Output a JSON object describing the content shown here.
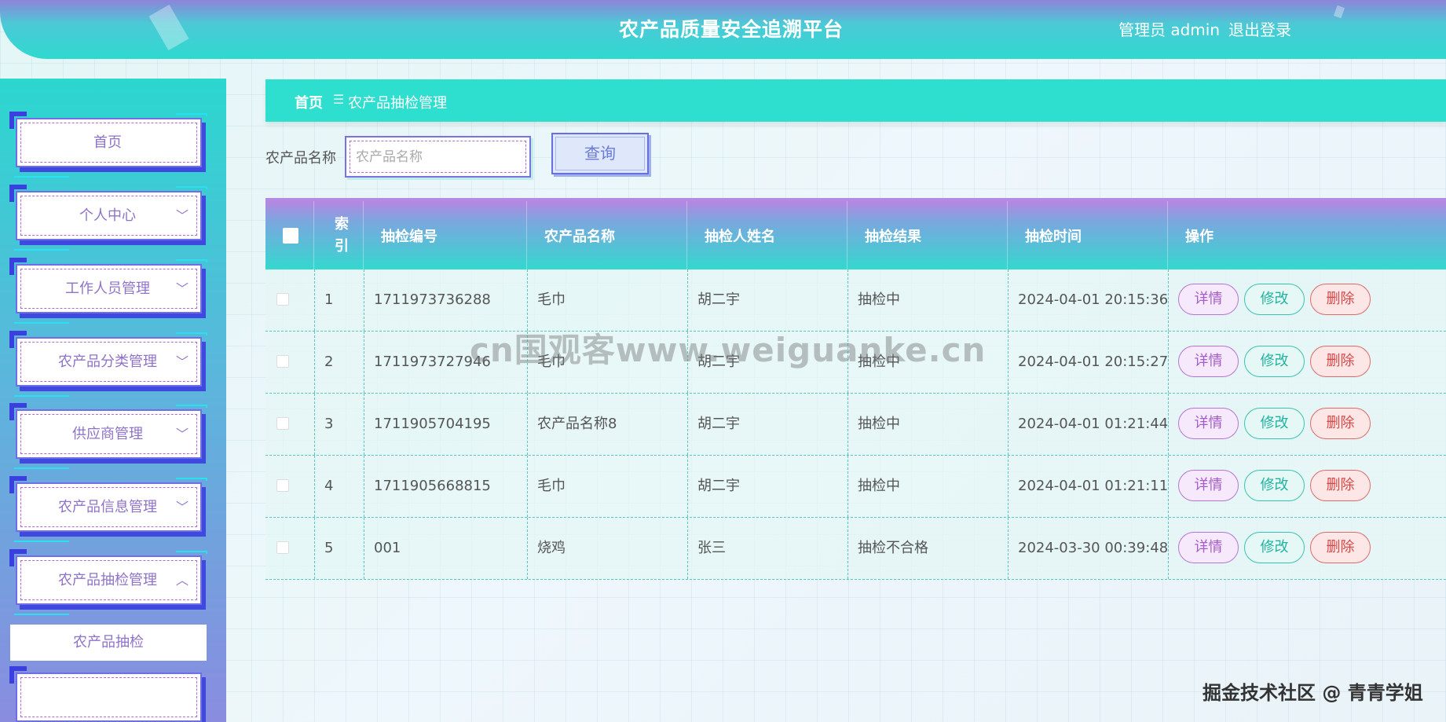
{
  "header": {
    "title": "农产品质量安全追溯平台",
    "user": "管理员 admin",
    "logout": "退出登录"
  },
  "sidebar": {
    "items": [
      {
        "label": "首页",
        "chevron": ""
      },
      {
        "label": "个人中心",
        "chevron": "﹀"
      },
      {
        "label": "工作人员管理",
        "chevron": "﹀"
      },
      {
        "label": "农产品分类管理",
        "chevron": "﹀"
      },
      {
        "label": "供应商管理",
        "chevron": "﹀"
      },
      {
        "label": "农产品信息管理",
        "chevron": "﹀"
      },
      {
        "label": "农产品抽检管理",
        "chevron": "︿"
      }
    ],
    "submenu": "农产品抽检"
  },
  "breadcrumb": {
    "home": "首页",
    "separator": "☰",
    "current": "农产品抽检管理"
  },
  "search": {
    "label": "农产品名称",
    "placeholder": "农产品名称",
    "button": "查询"
  },
  "table": {
    "headers": [
      "索引",
      "抽检编号",
      "农产品名称",
      "抽检人姓名",
      "抽检结果",
      "抽检时间",
      "操作"
    ],
    "rows": [
      {
        "index": "1",
        "code": "1711973736288",
        "product": "毛巾",
        "inspector": "胡二宇",
        "result": "抽检中",
        "time": "2024-04-01 20:15:36"
      },
      {
        "index": "2",
        "code": "1711973727946",
        "product": "毛巾",
        "inspector": "胡二宇",
        "result": "抽检中",
        "time": "2024-04-01 20:15:27"
      },
      {
        "index": "3",
        "code": "1711905704195",
        "product": "农产品名称8",
        "inspector": "胡二宇",
        "result": "抽检中",
        "time": "2024-04-01 01:21:44"
      },
      {
        "index": "4",
        "code": "1711905668815",
        "product": "毛巾",
        "inspector": "胡二宇",
        "result": "抽检中",
        "time": "2024-04-01 01:21:11"
      },
      {
        "index": "5",
        "code": "001",
        "product": "烧鸡",
        "inspector": "张三",
        "result": "抽检不合格",
        "time": "2024-03-30 00:39:48"
      }
    ],
    "actions": {
      "detail": "详情",
      "edit": "修改",
      "delete": "删除"
    }
  },
  "watermark": "cn国观客www.weiguanke.cn",
  "corner_mark": "掘金技术社区 @ 青青学姐",
  "colors": {
    "accent": "#2edfd0",
    "purple": "#8f72c9",
    "header_top": "#8d84da"
  }
}
